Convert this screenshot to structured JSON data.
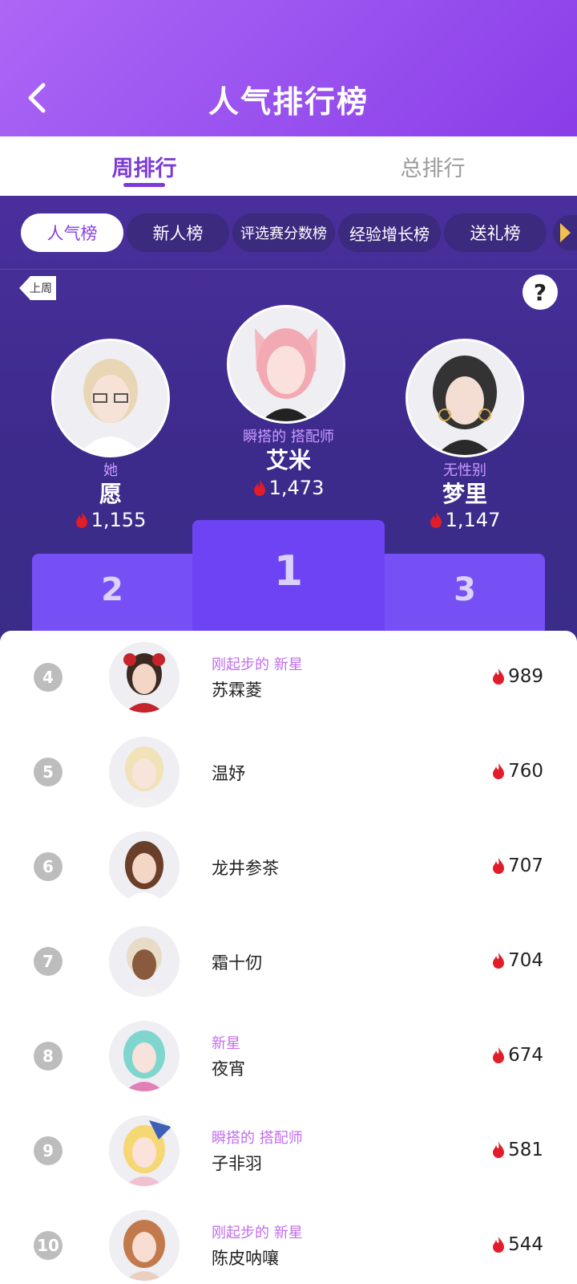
{
  "header": {
    "title": "人气排行榜"
  },
  "tabs": [
    {
      "label": "周排行"
    },
    {
      "label": "总排行"
    }
  ],
  "categories": [
    {
      "label": "人气榜"
    },
    {
      "label": "新人榜"
    },
    {
      "label": "评选赛分数榜"
    },
    {
      "label": "经验增长榜"
    },
    {
      "label": "送礼榜"
    }
  ],
  "last_week_label": "上周",
  "help_label": "?",
  "top3": [
    {
      "rank": 2,
      "tag": "她",
      "name": "愿",
      "score": "1,155"
    },
    {
      "rank": 1,
      "tag": "瞬搭的 搭配师",
      "name": "艾米",
      "score": "1,473"
    },
    {
      "rank": 3,
      "tag": "无性别",
      "name": "梦里",
      "score": "1,147"
    }
  ],
  "podium": {
    "first": "1",
    "second": "2",
    "third": "3"
  },
  "list": [
    {
      "rank": "4",
      "tag": "刚起步的 新星",
      "name": "苏霖菱",
      "score": "989"
    },
    {
      "rank": "5",
      "tag": "",
      "name": "温妤",
      "score": "760"
    },
    {
      "rank": "6",
      "tag": "",
      "name": "龙井参茶",
      "score": "707"
    },
    {
      "rank": "7",
      "tag": "",
      "name": "霜十仞",
      "score": "704"
    },
    {
      "rank": "8",
      "tag": "新星",
      "name": "夜宵",
      "score": "674"
    },
    {
      "rank": "9",
      "tag": "瞬搭的 搭配师",
      "name": "子非羽",
      "score": "581"
    },
    {
      "rank": "10",
      "tag": "刚起步的 新星",
      "name": "陈皮呐嚷",
      "score": "544"
    }
  ],
  "colors": {
    "accent": "#7c3ad9",
    "flame": "#e11d2a",
    "header": "#9a53ef",
    "podium": "#7650f5"
  }
}
